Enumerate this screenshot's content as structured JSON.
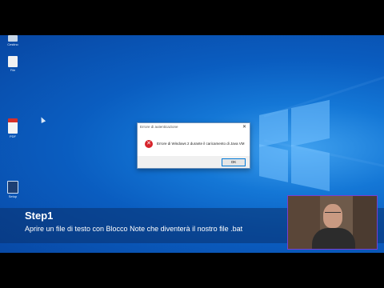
{
  "desktop": {
    "icons": [
      {
        "label": "Cestino"
      },
      {
        "label": "File"
      },
      {
        "label": "PDF"
      },
      {
        "label": "Setup"
      }
    ]
  },
  "dialog": {
    "title": "Errore di autenticazione",
    "message": "Errore di Windows 2 durante il caricamento di Java VM",
    "ok_label": "OK",
    "close_glyph": "✕",
    "icon_glyph": "✕"
  },
  "step": {
    "title": "Step1",
    "text": "Aprire un file di testo con Blocco Note che diventerà il nostro file .bat"
  }
}
